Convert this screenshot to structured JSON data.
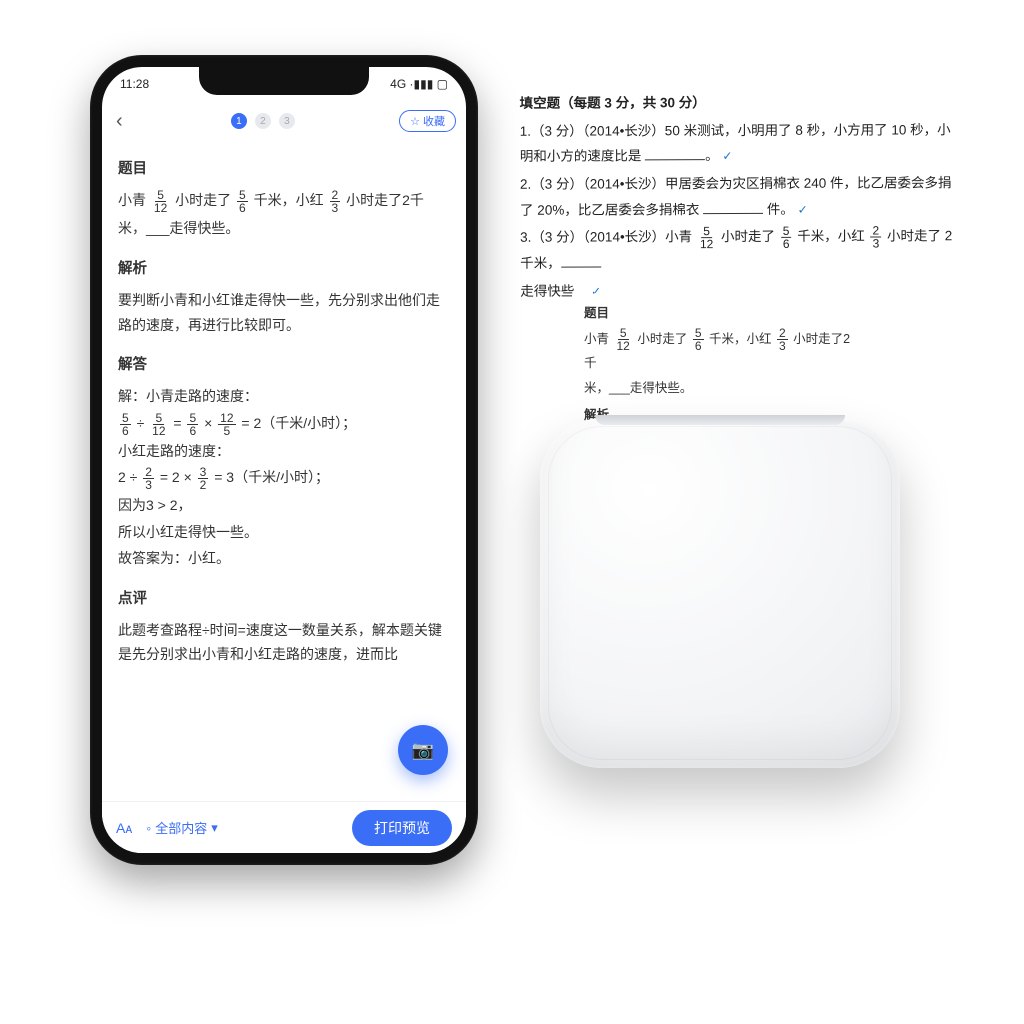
{
  "status": {
    "time": "11:28",
    "right": "4G ·▮▮▮ ▢"
  },
  "topbar": {
    "dots": [
      "1",
      "2",
      "3"
    ],
    "pill_icon": "☆",
    "pill_label": "收藏"
  },
  "sections": {
    "q_title": "题目",
    "q_body_pre": "小青 ",
    "q_body_mid1": " 小时走了 ",
    "q_body_mid2": " 千米，小红 ",
    "q_body_mid3": " 小时走了2千",
    "q_body_line2": "米，___走得快些。",
    "a_title": "解析",
    "a_body": "要判断小青和小红谁走得快一些，先分别求出他们走路的速度，再进行比较即可。",
    "s_title": "解答",
    "s_l1": "解：小青走路的速度：",
    "s_l2a": " ÷ ",
    "s_l2b": " = ",
    "s_l2c": " × ",
    "s_l2d": " = 2（千米/小时）；",
    "s_l3": "小红走路的速度：",
    "s_l4a": "2 ÷ ",
    "s_l4b": " = 2 × ",
    "s_l4c": " = 3（千米/小时）；",
    "s_l5": "因为3 > 2，",
    "s_l6": "所以小红走得快一些。",
    "s_l7": "故答案为：小红。",
    "c_title": "点评",
    "c_body": "此题考查路程÷时间=速度这一数量关系，解本题关键是先分别求出小青和小红走路的速度，进而比"
  },
  "bottombar": {
    "format": "Aᴀ",
    "mode_icon": "◦",
    "mode_label": "全部内容",
    "chev": "▾",
    "print": "打印预览"
  },
  "fab_icon": "📷",
  "paper": {
    "title": "填空题（每题 3 分，共 30 分）",
    "l1": "1.（3 分）（2014•长沙）50 米测试，小明用了 8 秒，小方用了 10 秒，小明和小方的速度比是 ",
    "l1_end": "。",
    "l2": "2.（3 分）（2014•长沙）甲居委会为灾区捐棉衣 240 件，比乙居委会多捐了 20%，比乙居委会多捐棉衣 ",
    "l2_end": " 件。",
    "l3a": "3.（3 分）（2014•长沙）小青 ",
    "l3b": " 小时走了 ",
    "l3c": " 千米，小红 ",
    "l3d": " 小时走了 2 千米，",
    "l3_end": "走得快些。"
  },
  "strip": {
    "h1": "题目",
    "b1a": "小青 ",
    "b1b": " 小时走了 ",
    "b1c": " 千米，小红 ",
    "b1d": " 小时走了2千",
    "b2": "米，___走得快些。",
    "h2": "解析"
  },
  "fracs": {
    "五_12": {
      "n": "5",
      "d": "12"
    },
    "五_6": {
      "n": "5",
      "d": "6"
    },
    "二_3": {
      "n": "2",
      "d": "3"
    },
    "十二_5": {
      "n": "12",
      "d": "5"
    },
    "三_2": {
      "n": "3",
      "d": "2"
    }
  }
}
